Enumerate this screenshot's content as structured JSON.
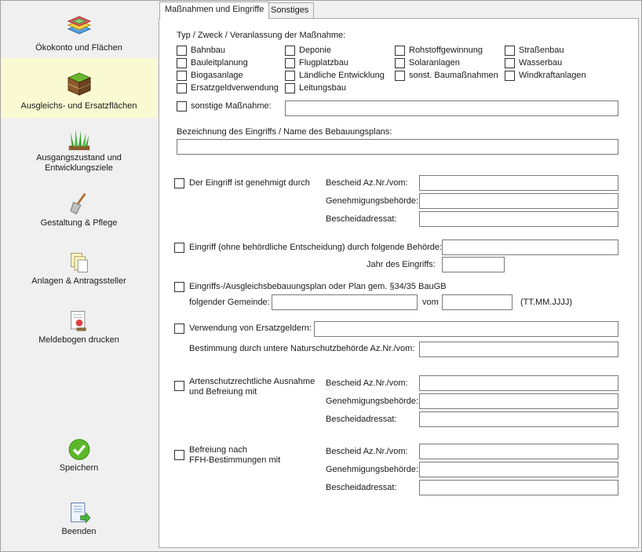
{
  "sidebar": {
    "items": [
      {
        "label": "Ökokonto und Flächen"
      },
      {
        "label": "Ausgleichs- und Ersatzflächen"
      },
      {
        "label": "Ausgangszustand und Entwicklungsziele"
      },
      {
        "label": "Gestaltung & Pflege"
      },
      {
        "label": "Anlagen & Antragssteller"
      },
      {
        "label": "Meldebogen drucken"
      }
    ],
    "save_label": "Speichern",
    "exit_label": "Beenden"
  },
  "tabs": [
    {
      "label": "Maßnahmen und Eingriffe"
    },
    {
      "label": "Sonstiges"
    }
  ],
  "form": {
    "type_header": "Typ / Zweck / Veranlassung der Maßnahme:",
    "types_col1": [
      "Bahnbau",
      "Bauleitplanung",
      "Biogasanlage",
      "Ersatzgeldverwendung"
    ],
    "types_col2": [
      "Deponie",
      "Flugplatzbau",
      "Ländliche Entwicklung",
      "Leitungsbau"
    ],
    "types_col3": [
      "Rohstoffgewinnung",
      "Solaranlagen",
      "sonst. Baumaßnahmen"
    ],
    "types_col4": [
      "Straßenbau",
      "Wasserbau",
      "Windkraftanlagen"
    ],
    "other_measure_label": "sonstige Maßnahme:",
    "other_measure_value": "",
    "designation_label": "Bezeichnung des Eingriffs / Name des Bebauungsplans:",
    "designation_value": "",
    "approved_label": "Der Eingriff ist genehmigt durch",
    "bescheid_label": "Bescheid Az.Nr./vom:",
    "behoerde_label": "Genehmigungsbehörde:",
    "adressat_label": "Bescheidadressat:",
    "no_decision_label": "Eingriff (ohne behördliche Entscheidung) durch folgende Behörde:",
    "year_label": "Jahr des Eingriffs:",
    "plan_label": "Eingriffs-/Ausgleichsbebauungsplan oder Plan gem. §34/35 BauGB",
    "municipality_label": "folgender Gemeinde:",
    "vom_label": "vom",
    "date_format": "(TT.MM.JJJJ)",
    "replacement_money_label": "Verwendung von Ersatzgeldern:",
    "determination_label": "Bestimmung durch untere Naturschutzbehörde Az.Nr./vom:",
    "species_label_1": "Artenschutzrechtliche Ausnahme",
    "species_label_2": "und Befreiung mit",
    "ffh_label_1": "Befreiung nach",
    "ffh_label_2": "FFH-Bestimmungen mit"
  }
}
